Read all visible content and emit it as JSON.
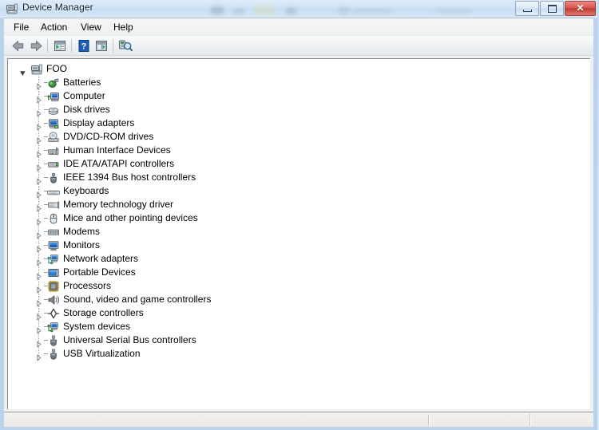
{
  "window": {
    "title": "Device Manager",
    "title_icon": "device-manager-icon",
    "controls": {
      "minimize_label": "–",
      "maximize_label": "□",
      "close_label": "✕"
    }
  },
  "colors": {
    "close_button": "#c03a31",
    "window_frame": "#b9d3ec",
    "content_background": "#ffffff",
    "toolbar_background": "#eef1f3",
    "statusbar_background": "#edeae7",
    "text": "#000000"
  },
  "menubar": {
    "items": [
      {
        "label": "File",
        "name": "menu-file"
      },
      {
        "label": "Action",
        "name": "menu-action"
      },
      {
        "label": "View",
        "name": "menu-view"
      },
      {
        "label": "Help",
        "name": "menu-help"
      }
    ]
  },
  "toolbar": {
    "buttons": [
      {
        "name": "back-button",
        "icon": "back-arrow-icon"
      },
      {
        "name": "forward-button",
        "icon": "forward-arrow-icon"
      },
      {
        "name": "properties-button",
        "icon": "properties-icon"
      },
      {
        "name": "help-button",
        "icon": "help-question-icon"
      },
      {
        "name": "show-hide-console-tree-button",
        "icon": "show-hide-tree-icon"
      },
      {
        "name": "scan-hardware-changes-button",
        "icon": "scan-hardware-icon"
      }
    ]
  },
  "tree": {
    "root": {
      "label": "FOO",
      "icon": "computer-root-icon",
      "expanded": true
    },
    "items": [
      {
        "label": "Batteries",
        "icon": "battery-icon"
      },
      {
        "label": "Computer",
        "icon": "computer-icon"
      },
      {
        "label": "Disk drives",
        "icon": "disk-drive-icon"
      },
      {
        "label": "Display adapters",
        "icon": "display-adapter-icon"
      },
      {
        "label": "DVD/CD-ROM drives",
        "icon": "dvd-drive-icon"
      },
      {
        "label": "Human Interface Devices",
        "icon": "hid-icon"
      },
      {
        "label": "IDE ATA/ATAPI controllers",
        "icon": "ide-controller-icon"
      },
      {
        "label": "IEEE 1394 Bus host controllers",
        "icon": "ieee1394-icon"
      },
      {
        "label": "Keyboards",
        "icon": "keyboard-icon"
      },
      {
        "label": "Memory technology driver",
        "icon": "memory-icon"
      },
      {
        "label": "Mice and other pointing devices",
        "icon": "mouse-icon"
      },
      {
        "label": "Modems",
        "icon": "modem-icon"
      },
      {
        "label": "Monitors",
        "icon": "monitor-icon"
      },
      {
        "label": "Network adapters",
        "icon": "network-adapter-icon"
      },
      {
        "label": "Portable Devices",
        "icon": "portable-device-icon"
      },
      {
        "label": "Processors",
        "icon": "processor-icon"
      },
      {
        "label": "Sound, video and game controllers",
        "icon": "sound-icon"
      },
      {
        "label": "Storage controllers",
        "icon": "storage-controller-icon"
      },
      {
        "label": "System devices",
        "icon": "system-device-icon"
      },
      {
        "label": "Universal Serial Bus controllers",
        "icon": "usb-controller-icon"
      },
      {
        "label": "USB Virtualization",
        "icon": "usb-virtualization-icon"
      }
    ]
  },
  "statusbar": {
    "panes": [
      {
        "name": "status-pane-main",
        "text": ""
      },
      {
        "name": "status-pane-second",
        "text": ""
      },
      {
        "name": "status-pane-third",
        "text": ""
      }
    ]
  }
}
